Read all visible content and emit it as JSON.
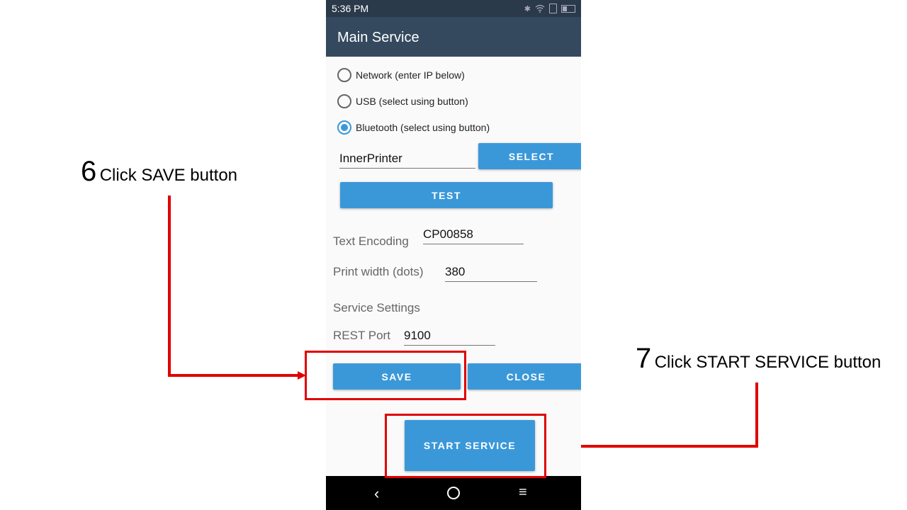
{
  "status": {
    "time": "5:36 PM"
  },
  "appbar": {
    "title": "Main Service"
  },
  "connection": {
    "options": [
      {
        "label": "Network (enter IP below)",
        "checked": false
      },
      {
        "label": "USB (select using button)",
        "checked": false
      },
      {
        "label": "Bluetooth (select using button)",
        "checked": true
      }
    ],
    "printer_name": "InnerPrinter",
    "select_label": "SELECT",
    "test_label": "TEST"
  },
  "settings": {
    "encoding_label": "Text Encoding",
    "encoding_value": "CP00858",
    "width_label": "Print width (dots)",
    "width_value": "380",
    "service_heading": "Service Settings",
    "port_label": "REST Port",
    "port_value": "9100"
  },
  "actions": {
    "save_label": "SAVE",
    "close_label": "CLOSE",
    "start_label": "START SERVICE"
  },
  "annotations": {
    "step6_num": "6",
    "step6_text": "Click SAVE button",
    "step7_num": "7",
    "step7_text": "Click START SERVICE button"
  },
  "colors": {
    "accent": "#3b98d8",
    "appbar": "#34495e",
    "annotation_red": "#e00000"
  }
}
